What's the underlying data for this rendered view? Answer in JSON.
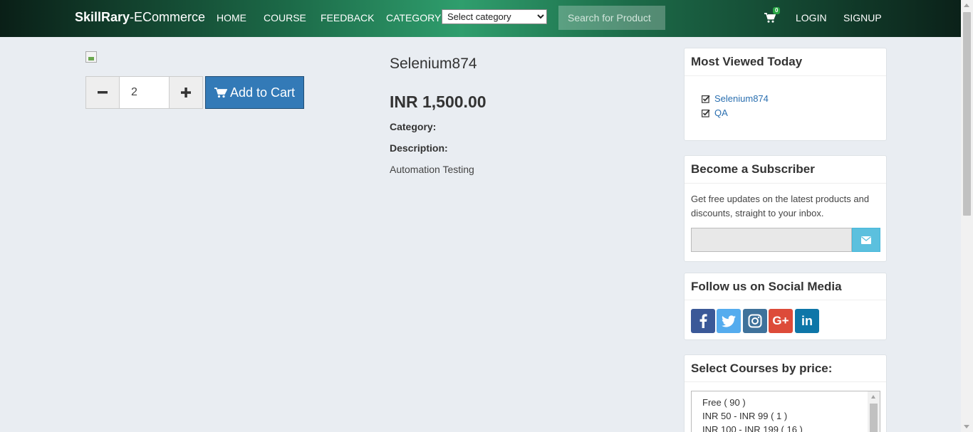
{
  "navbar": {
    "brand_bold": "SkillRary",
    "brand_rest": "-ECommerce",
    "links": [
      "HOME",
      "COURSE",
      "FEEDBACK",
      "CATEGORY"
    ],
    "category_select": "Select category",
    "search_placeholder": "Search for Product",
    "cart_count": "0",
    "login": "LOGIN",
    "signup": "SIGNUP"
  },
  "product": {
    "quantity": "2",
    "add_to_cart": "Add to Cart",
    "title": "Selenium874",
    "price": "INR 1,500.00",
    "category_label": "Category:",
    "description_label": "Description:",
    "description": "Automation Testing"
  },
  "sidebar": {
    "most_viewed": {
      "title": "Most Viewed Today",
      "items": [
        "Selenium874",
        "QA"
      ]
    },
    "subscriber": {
      "title": "Become a Subscriber",
      "text": "Get free updates on the latest products and discounts, straight to your inbox."
    },
    "social": {
      "title": "Follow us on Social Media",
      "icons": [
        "facebook-icon",
        "twitter-icon",
        "instagram-icon",
        "google-plus-icon",
        "linkedin-icon"
      ]
    },
    "price_filter": {
      "title": "Select Courses by price:",
      "options": [
        "Free ( 90 )",
        "INR 50 - INR 99 ( 1 )",
        "INR 100 - INR 199 ( 16 )"
      ]
    }
  },
  "colors": {
    "nav_accent": "#2f9e6d",
    "add_cart": "#337ab7",
    "link": "#2a6fb0",
    "subscribe_btn": "#5bc0de",
    "facebook": "#3b5998",
    "twitter": "#55acee",
    "instagram": "#3f729b",
    "google_plus": "#dd4b39",
    "linkedin": "#0e76a8"
  }
}
